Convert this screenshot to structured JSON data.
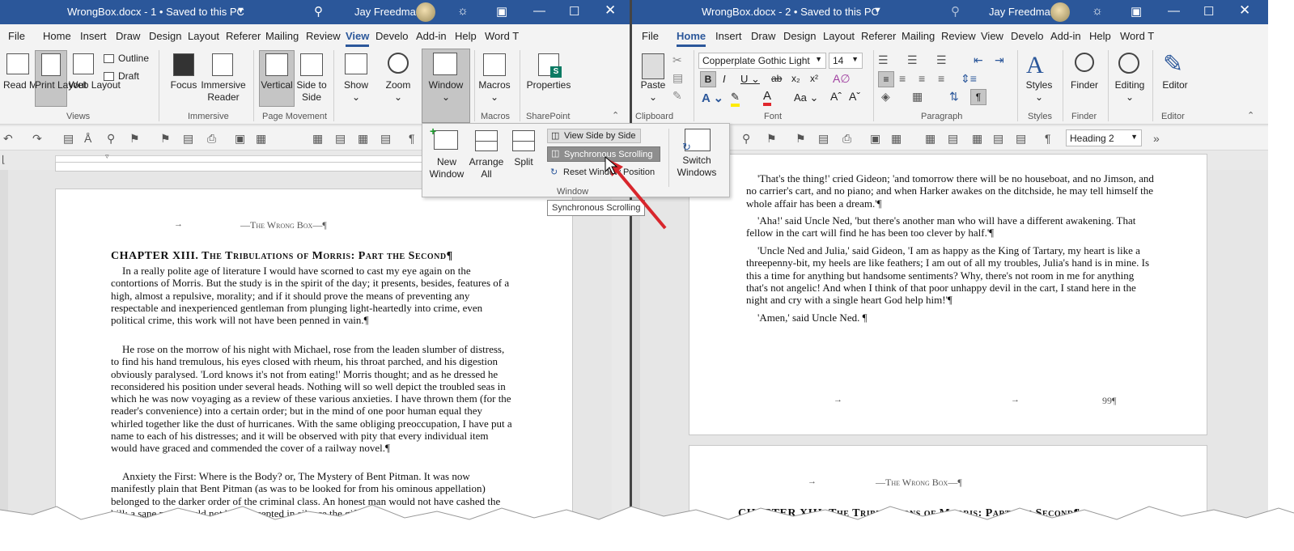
{
  "left_window": {
    "title": "WrongBox.docx  -  1  •  Saved to this PC",
    "user": "Jay Freedman",
    "tabs": [
      "File",
      "Home",
      "Insert",
      "Draw",
      "Design",
      "Layout",
      "Referer",
      "Mailing",
      "Review",
      "View",
      "Develo",
      "Add-in",
      "Help",
      "Word T"
    ],
    "active_tab": "View",
    "ribbon": {
      "views": {
        "read_mode": "Read Mode",
        "print_layout": "Print Layout",
        "web_layout": "Web Layout",
        "outline": "Outline",
        "draft": "Draft",
        "group": "Views"
      },
      "immersive": {
        "focus": "Focus",
        "immersive_reader": "Immersive Reader",
        "group": "Immersive"
      },
      "page_movement": {
        "vertical": "Vertical",
        "side_to_side": "Side to Side",
        "group": "Page Movement"
      },
      "show": "Show",
      "zoom": "Zoom",
      "window": "Window",
      "macros": {
        "label": "Macros",
        "group": "Macros"
      },
      "sharepoint": {
        "label": "Properties",
        "group": "SharePoint"
      }
    },
    "document": {
      "header": "—The Wrong Box—¶",
      "chapter": "CHAPTER XIII. The Tribulations of Morris: Part the Second¶",
      "paragraphs": [
        "In a really polite age of literature I would have scorned to cast my eye again on the contortions of Morris. But the study is in the spirit of the day; it presents, besides, features of a high, almost a repulsive, morality; and if it should prove the means of preventing any respectable and inexperienced gentleman from plunging light-heartedly into crime, even political crime, this work will not have been penned in vain.¶",
        "He rose on the morrow of his night with Michael, rose from the leaden slumber of distress, to find his hand tremulous, his eyes closed with rheum, his throat parched, and his digestion obviously paralysed. 'Lord knows it's not from eating!' Morris thought; and as he dressed he reconsidered his position under several heads. Nothing will so well depict the troubled seas in which he was now voyaging as a review of these various anxieties. I have thrown them (for the reader's convenience) into a certain order; but in the mind of one poor human equal they whirled together like the dust of hurricanes. With the same obliging preoccupation, I have put a name to each of his distresses; and it will be observed with pity that every individual item would have graced and commended the cover of a railway novel.¶",
        "Anxiety the First: Where is the Body? or, The Mystery of Bent Pitman. It was now manifestly plain that Bent Pitman (as was to be looked for from his ominous appellation) belonged to the darker order of the criminal class. An honest man would not have cashed the bill; a sane man would not have accepted in silence the gift"
      ]
    }
  },
  "window_dropdown": {
    "new_window": "New Window",
    "arrange_all": "Arrange All",
    "split": "Split",
    "view_side_by_side": "View Side by Side",
    "synchronous_scrolling": "Synchronous Scrolling",
    "reset_window_position": "Reset Window Position",
    "switch_windows": "Switch Windows",
    "group": "Window",
    "tooltip": "Synchronous Scrolling"
  },
  "right_window": {
    "title": "WrongBox.docx  -  2  •  Saved to this PC",
    "user": "Jay Freedman",
    "tabs": [
      "File",
      "Home",
      "Insert",
      "Draw",
      "Design",
      "Layout",
      "Referer",
      "Mailing",
      "Review",
      "View",
      "Develo",
      "Add-in",
      "Help",
      "Word T"
    ],
    "active_tab": "Home",
    "ribbon": {
      "paste": "Paste",
      "clipboard_group": "Clipboard",
      "font_name": "Copperplate Gothic Light",
      "font_size": "14",
      "font_group": "Font",
      "paragraph_group": "Paragraph",
      "styles": "Styles",
      "styles_group": "Styles",
      "finder": "Finder",
      "finder_group": "Finder",
      "editing": "Editing",
      "editor": "Editor",
      "editor_group": "Editor"
    },
    "style_box": "Heading 2",
    "document": {
      "paragraphs": [
        "'That's the thing!' cried Gideon; 'and tomorrow there will be no houseboat, and no Jimson, and no carrier's cart, and no piano; and when Harker awakes on the ditchside, he may tell himself the whole affair has been a dream.'¶",
        "'Aha!' said Uncle Ned, 'but there's another man who will have a different awakening. That fellow in the cart will find he has been too clever by half.'¶",
        "'Uncle Ned and Julia,' said Gideon, 'I am as happy as the King of Tartary, my heart is like a threepenny-bit, my heels are like feathers; I am out of all my troubles, Julia's hand is in mine. Is this a time for anything but handsome sentiments? Why, there's not room in me for anything that's not angelic! And when I think of that poor unhappy devil in the cart, I stand here in the night and cry with a single heart God help him!'¶",
        "'Amen,' said Uncle Ned. ¶"
      ],
      "page_number": "99¶",
      "header": "—The Wrong Box—¶",
      "chapter": "CHAPTER XIII. The Tribulations of Morris: Part the Second¶"
    }
  },
  "colors": {
    "title_bar": "#2b579a",
    "ribbon": "#f3f3f3",
    "arrow": "#d8262c",
    "selected": "#c5c5c5"
  }
}
